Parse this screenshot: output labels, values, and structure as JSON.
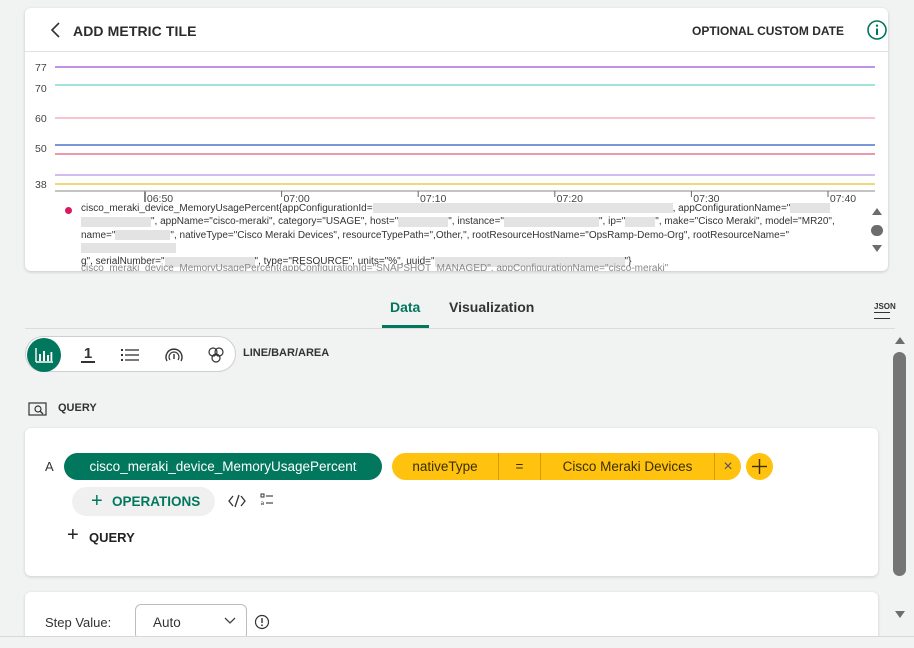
{
  "header": {
    "title": "ADD METRIC TILE",
    "custom_date_label": "OPTIONAL CUSTOM DATE"
  },
  "chart_data": {
    "type": "line",
    "x_ticks": [
      "06:50",
      "07:00",
      "07:10",
      "07:20",
      "07:30",
      "07:40"
    ],
    "y_ticks": [
      38,
      50,
      60,
      70,
      77
    ],
    "y_range": [
      37,
      78
    ],
    "series": [
      {
        "values": [
          77,
          77
        ],
        "color": "#9c4fd6"
      },
      {
        "values": [
          71,
          71
        ],
        "color": "#6bd4c8"
      },
      {
        "values": [
          60,
          60
        ],
        "color": "#f4a0b0"
      },
      {
        "values": [
          51,
          51
        ],
        "color": "#2b56c4"
      },
      {
        "values": [
          48,
          48
        ],
        "color": "#e05a7a"
      },
      {
        "values": [
          41,
          41
        ],
        "color": "#b894e6"
      },
      {
        "values": [
          38,
          38
        ],
        "color": "#e8c22a"
      }
    ]
  },
  "legend": {
    "name": "cisco_meraki_device_MemoryUsagePercent",
    "seg1": "{appConfigurationId=",
    "seg2": ", appConfigurationName=\"",
    "seg3": "\", appName=\"cisco-meraki\", category=\"USAGE\", host=\"",
    "seg4": "\", instance=\"",
    "seg5": "\", ip=\"",
    "seg6": "\", make=\"Cisco Meraki\", model=\"MR20\", name=\"",
    "seg7": "\", nativeType=\"Cisco Meraki Devices\", resourceTypePath=\",Other,\", rootResourceHostName=\"OpsRamp-Demo-Org\", rootResourceName=\"",
    "seg8": "g\", serialNumber=\"",
    "seg9": "\", type=\"RESOURCE\", units=\"%\", uuid=\"",
    "seg10": "\"}",
    "next_line": "cisco_meraki_device_MemoryUsagePercent{appConfigurationId=\"SNAPSHOT_MANAGED\", appConfigurationName=\"cisco-meraki\""
  },
  "tabs": {
    "data": "Data",
    "visualization": "Visualization",
    "json": "JSON"
  },
  "viz": {
    "single_value_glyph": "1",
    "label": "LINE/BAR/AREA"
  },
  "query_section": {
    "heading": "QUERY"
  },
  "query": {
    "letter": "A",
    "metric": "cisco_meraki_device_MemoryUsagePercent",
    "filter_key": "nativeType",
    "filter_op": "=",
    "filter_value": "Cisco Meraki Devices",
    "remove_glyph": "×",
    "add_glyph": "+",
    "operations_label": "OPERATIONS",
    "add_query_label": "QUERY"
  },
  "step": {
    "label": "Step Value:",
    "value": "Auto"
  },
  "colors": {
    "accent": "#01775d",
    "filter": "#ffc20e",
    "legend_dot": "#d81b60"
  }
}
